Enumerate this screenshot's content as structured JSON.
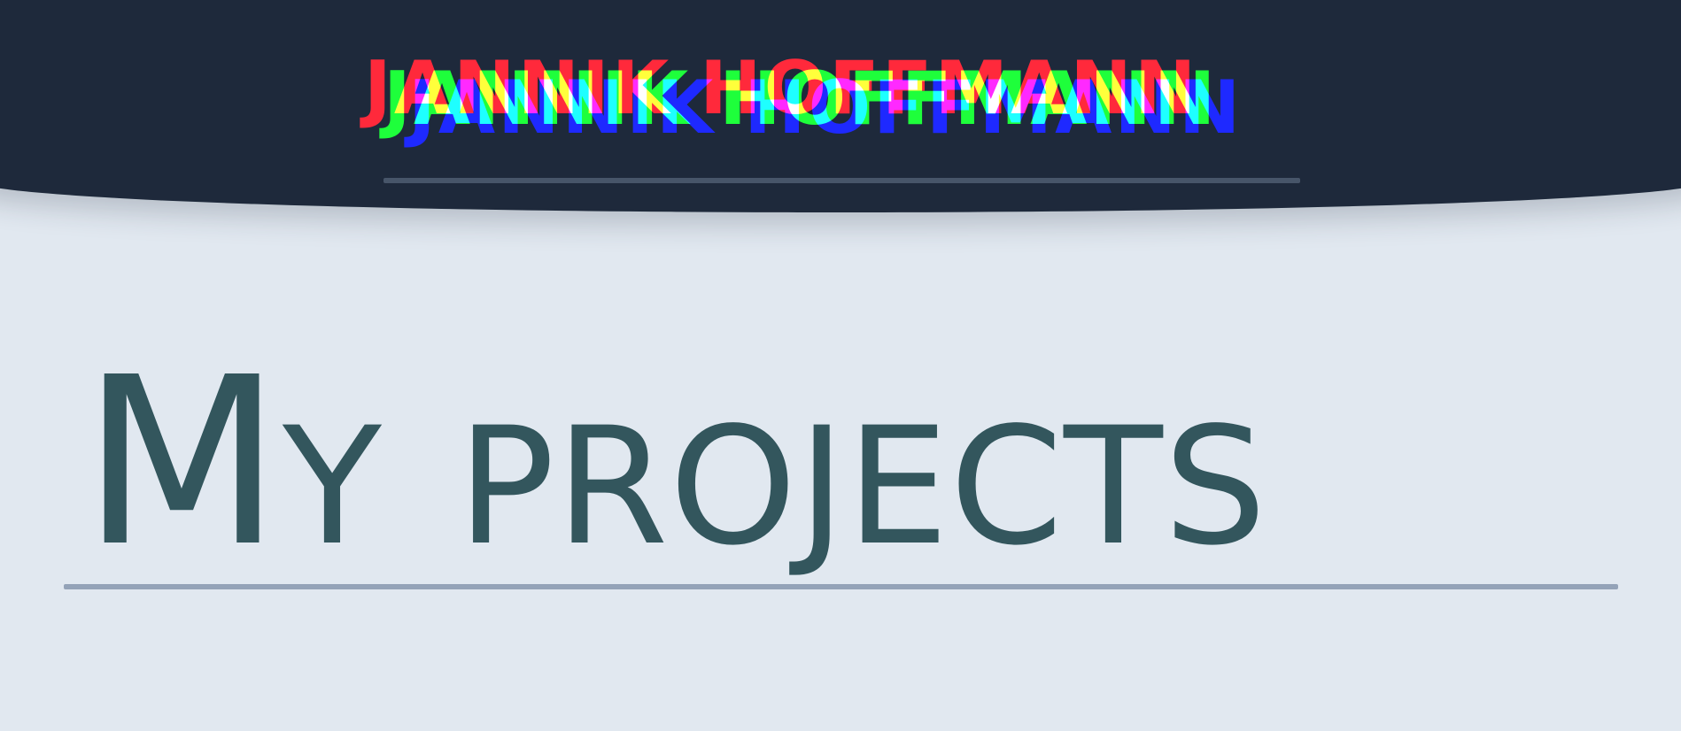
{
  "header": {
    "brand_name": "JANNIK HOFFMANN"
  },
  "main": {
    "page_title": "My projects"
  },
  "colors": {
    "header_background": "#1e293b",
    "page_background": "#e1e8f0",
    "title_text": "#33565d",
    "brand_divider": "#475569",
    "title_divider": "#94a3b8"
  }
}
